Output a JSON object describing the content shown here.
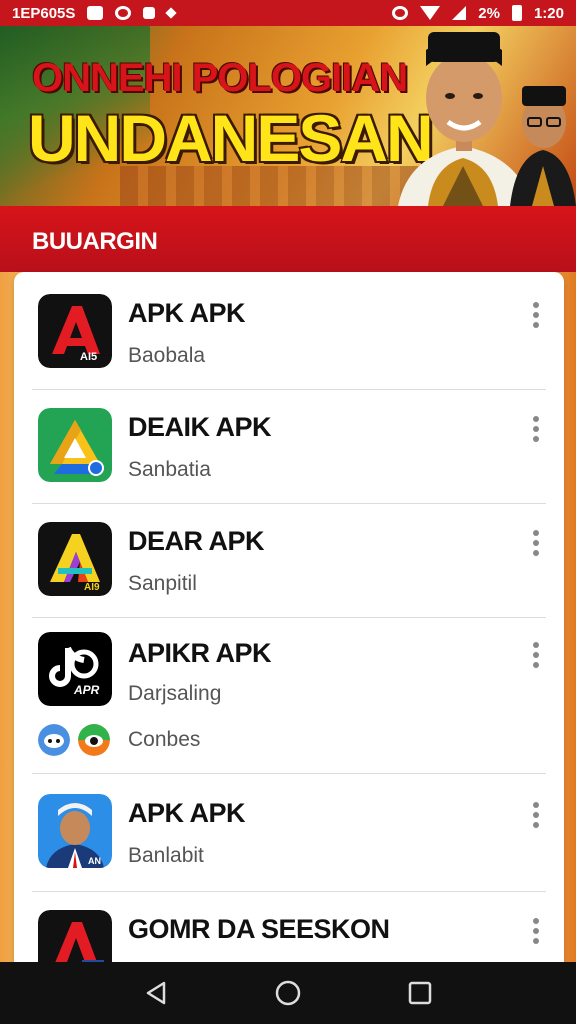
{
  "status_bar": {
    "left_text": "1EP605S",
    "right_text": "2%",
    "time": "1:20"
  },
  "banner": {
    "title_line1": "ONNEHI POLOGIIAN",
    "title_line2": "UNDANESAN"
  },
  "section": {
    "title": "BUUARGIN"
  },
  "apps": [
    {
      "name": "APK APK",
      "subtitle": "Baobala",
      "icon": "red-a-icon",
      "icon_text": "AI5"
    },
    {
      "name": "DEAIK APK",
      "subtitle": "Sanbatia",
      "icon": "drive-triangle-icon",
      "icon_text": ""
    },
    {
      "name": "DEAR APK",
      "subtitle": "Sanpitil",
      "icon": "rainbow-a-icon",
      "icon_text": "AI9"
    },
    {
      "name": "APIKR APK",
      "subtitle": "Darjsaling",
      "icon": "tiktok-style-icon",
      "icon_text": "APR"
    },
    {
      "name": "APK APK",
      "subtitle": "Banlabit",
      "icon": "person-portrait-icon",
      "icon_text": "AN"
    },
    {
      "name": "GOMR DA SEESKON",
      "subtitle": "",
      "icon": "red-a-icon-2",
      "icon_text": ""
    }
  ],
  "extra_row": {
    "label": "Conbes"
  },
  "colors": {
    "primary_red": "#d7141a",
    "banner_yellow": "#ffe41a"
  }
}
